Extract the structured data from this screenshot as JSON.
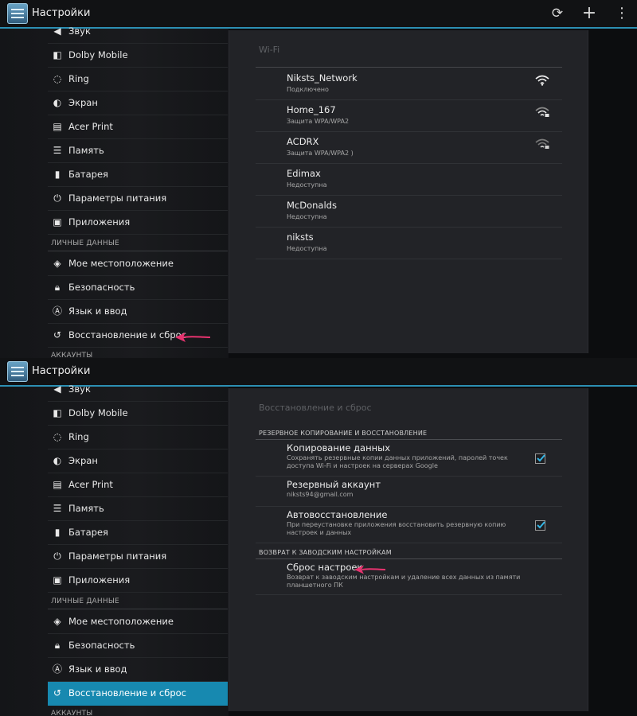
{
  "app": {
    "title": "Настройки",
    "actions": [
      "sync-icon",
      "add-icon",
      "overflow-menu-icon"
    ]
  },
  "sidebar": {
    "items": [
      {
        "label": "Звук",
        "icon": "volume-icon"
      },
      {
        "label": "Dolby Mobile",
        "icon": "dolby-icon"
      },
      {
        "label": "Ring",
        "icon": "ring-icon"
      },
      {
        "label": "Экран",
        "icon": "display-icon"
      },
      {
        "label": "Acer Print",
        "icon": "printer-icon"
      },
      {
        "label": "Память",
        "icon": "storage-icon"
      },
      {
        "label": "Батарея",
        "icon": "battery-icon"
      },
      {
        "label": "Параметры питания",
        "icon": "power-icon"
      },
      {
        "label": "Приложения",
        "icon": "apps-icon"
      }
    ],
    "personal_header": "ЛИЧНЫЕ ДАННЫЕ",
    "personal_items": [
      {
        "label": "Мое местоположение",
        "icon": "location-icon"
      },
      {
        "label": "Безопасность",
        "icon": "lock-icon"
      },
      {
        "label": "Язык и ввод",
        "icon": "language-icon"
      },
      {
        "label": "Восстановление и сброс",
        "icon": "restore-icon"
      }
    ],
    "accounts_header": "АККАУНТЫ"
  },
  "wifi_panel": {
    "title": "Wi-Fi",
    "networks": [
      {
        "name": "Niksts_Network",
        "status": "Подключено",
        "signal": "strong"
      },
      {
        "name": "Home_167",
        "status": "Защита WPA/WPA2",
        "signal": "medium"
      },
      {
        "name": "ACDRX",
        "status": "Защита WPA/WPA2 )",
        "signal": "weak"
      },
      {
        "name": "Edimax",
        "status": "Недоступна",
        "signal": "none"
      },
      {
        "name": "McDonalds",
        "status": "Недоступна",
        "signal": "none"
      },
      {
        "name": "niksts",
        "status": "Недоступна",
        "signal": "none"
      }
    ]
  },
  "reset_panel": {
    "title": "Восстановление и сброс",
    "backup_header": "РЕЗЕРВНОЕ КОПИРОВАНИЕ И ВОССТАНОВЛЕНИЕ",
    "backup_data": {
      "title": "Копирование данных",
      "description": "Сохранять резервные копии данных приложений, паролей точек доступа Wi-Fi и настроек на серверах Google",
      "checked": true
    },
    "backup_account": {
      "title": "Резервный аккаунт",
      "value": "niksts94@gmail.com"
    },
    "auto_restore": {
      "title": "Автовосстановление",
      "description": "При переустановке приложения восстановить резервную копию настроек и данных",
      "checked": true
    },
    "factory_header": "ВОЗВРАТ К ЗАВОДСКИМ НАСТРОЙКАМ",
    "factory_reset": {
      "title": "Сброс настроек",
      "description": "Возврат к заводским настройкам и удаление всех данных из памяти планшетного ПК"
    }
  },
  "colors": {
    "accent": "#2c8fb3",
    "selected": "#1789b0",
    "annotation_arrow": "#e8336f"
  }
}
